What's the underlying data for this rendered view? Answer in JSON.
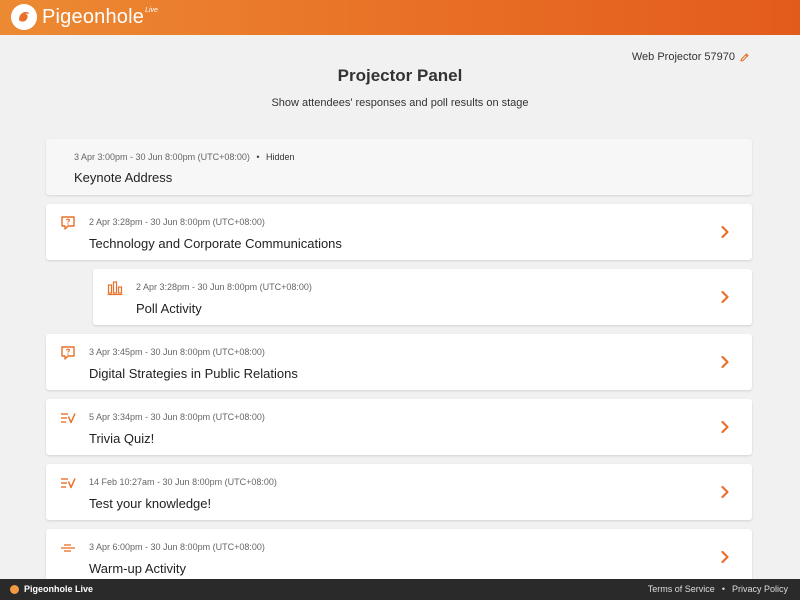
{
  "app": {
    "name": "Pigeonhole",
    "sup": "Live"
  },
  "header": {
    "projector_label": "Web Projector 57970"
  },
  "page": {
    "title": "Projector Panel",
    "subtitle": "Show attendees' responses and poll results on stage"
  },
  "session": {
    "meta": "3 Apr 3:00pm - 30 Jun 8:00pm (UTC+08:00)",
    "dot": "•",
    "status": "Hidden",
    "name": "Keynote Address"
  },
  "items": [
    {
      "icon": "qna-icon",
      "meta": "2 Apr 3:28pm - 30 Jun 8:00pm (UTC+08:00)",
      "name": "Technology and Corporate Communications"
    },
    {
      "icon": "poll-icon",
      "meta": "2 Apr 3:28pm - 30 Jun 8:00pm (UTC+08:00)",
      "name": "Poll Activity"
    },
    {
      "icon": "qna-icon",
      "meta": "3 Apr 3:45pm - 30 Jun 8:00pm (UTC+08:00)",
      "name": "Digital Strategies in Public Relations"
    },
    {
      "icon": "quiz-icon",
      "meta": "5 Apr 3:34pm - 30 Jun 8:00pm (UTC+08:00)",
      "name": "Trivia Quiz!"
    },
    {
      "icon": "quiz-icon",
      "meta": "14 Feb 10:27am - 30 Jun 8:00pm (UTC+08:00)",
      "name": "Test your knowledge!"
    },
    {
      "icon": "warmup-icon",
      "meta": "3 Apr 6:00pm - 30 Jun 8:00pm (UTC+08:00)",
      "name": "Warm-up Activity"
    }
  ],
  "footer": {
    "brand": "Pigeonhole Live",
    "terms": "Terms of Service",
    "sep": "•",
    "privacy": "Privacy Policy"
  },
  "colors": {
    "accent": "#e8702a",
    "header_start": "#ec8a33",
    "header_end": "#e35b1c"
  }
}
